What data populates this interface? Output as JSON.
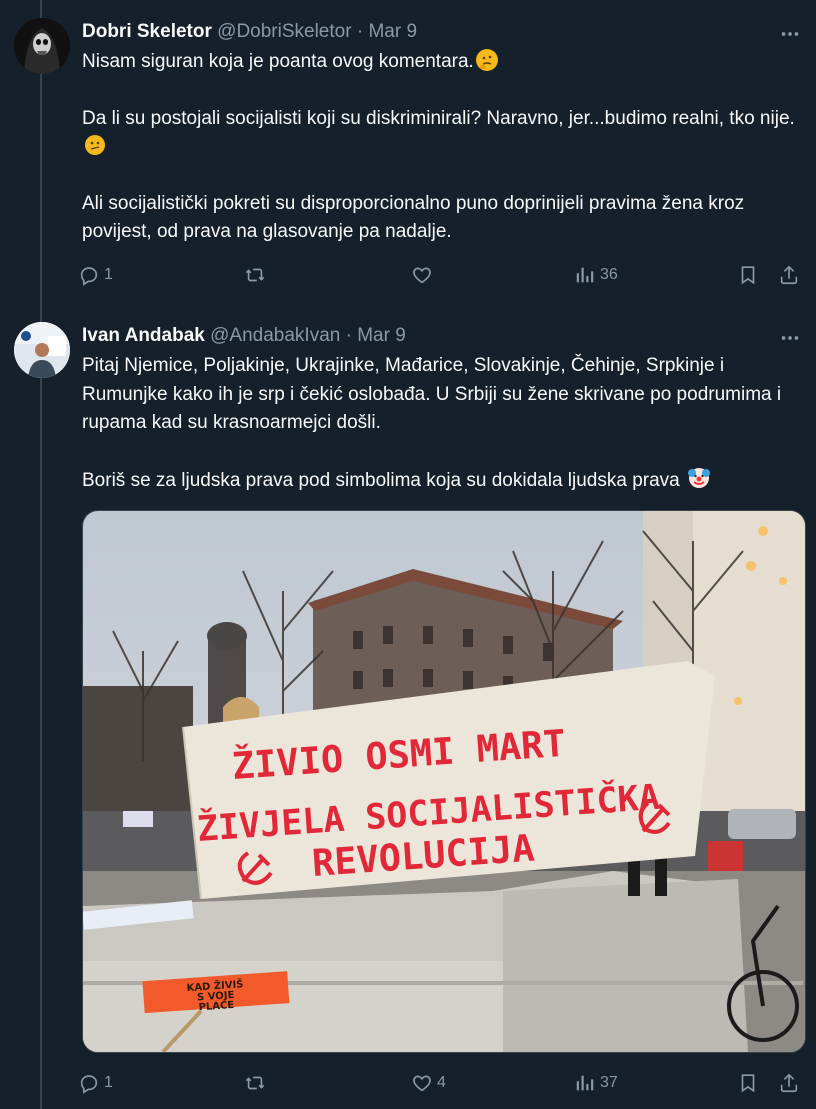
{
  "tweets": [
    {
      "name": "Dobri Skeletor",
      "handle": "@DobriSkeletor",
      "dot": "·",
      "date": "Mar 9",
      "paragraphs": [
        "Nisam siguran koja je poanta ovog komentara.",
        "Da li su postojali socijalisti koji su diskriminirali? Naravno, jer...budimo realni, tko nije.",
        "Ali socijalistički pokreti su disproporcionalno puno doprinijeli pravima žena kroz povijest, od prava na glasovanje pa nadalje."
      ],
      "emojis": [
        "thinking-face",
        "confused-face"
      ],
      "replies": "1",
      "retweets": "",
      "likes": "",
      "views": "36"
    },
    {
      "name": "Ivan Andabak",
      "handle": "@AndabakIvan",
      "dot": "·",
      "date": "Mar 9",
      "paragraphs": [
        "Pitaj Njemice, Poljakinje, Ukrajinke, Mađarice, Slovakinje, Čehinje, Srpkinje i Rumunjke kako ih je srp i čekić oslobađa. U Srbiji su žene skrivane po podrumima i rupama kad su krasnoarmejci došli.",
        "Boriš se za ljudska prava pod simbolima koja su dokidala ljudska prava"
      ],
      "emojis": [
        "clown-face"
      ],
      "replies": "1",
      "retweets": "",
      "likes": "4",
      "views": "37",
      "photo": {
        "banner_line1": "ŽIVIO OSMI MART",
        "banner_line2": "ŽIVJELA SOCIJALISTIČKA",
        "banner_line3": "REVOLUCIJA",
        "sign_text": "KAD ŽIVIŠ\nS VOJE\nPLAĆE"
      }
    }
  ],
  "icons": [
    "reply-icon",
    "retweet-icon",
    "like-icon",
    "views-icon",
    "bookmark-icon",
    "share-icon",
    "more-icon"
  ],
  "colors": {
    "background": "#15202b",
    "secondary_text": "#8b98a5",
    "divider": "#38444d"
  }
}
